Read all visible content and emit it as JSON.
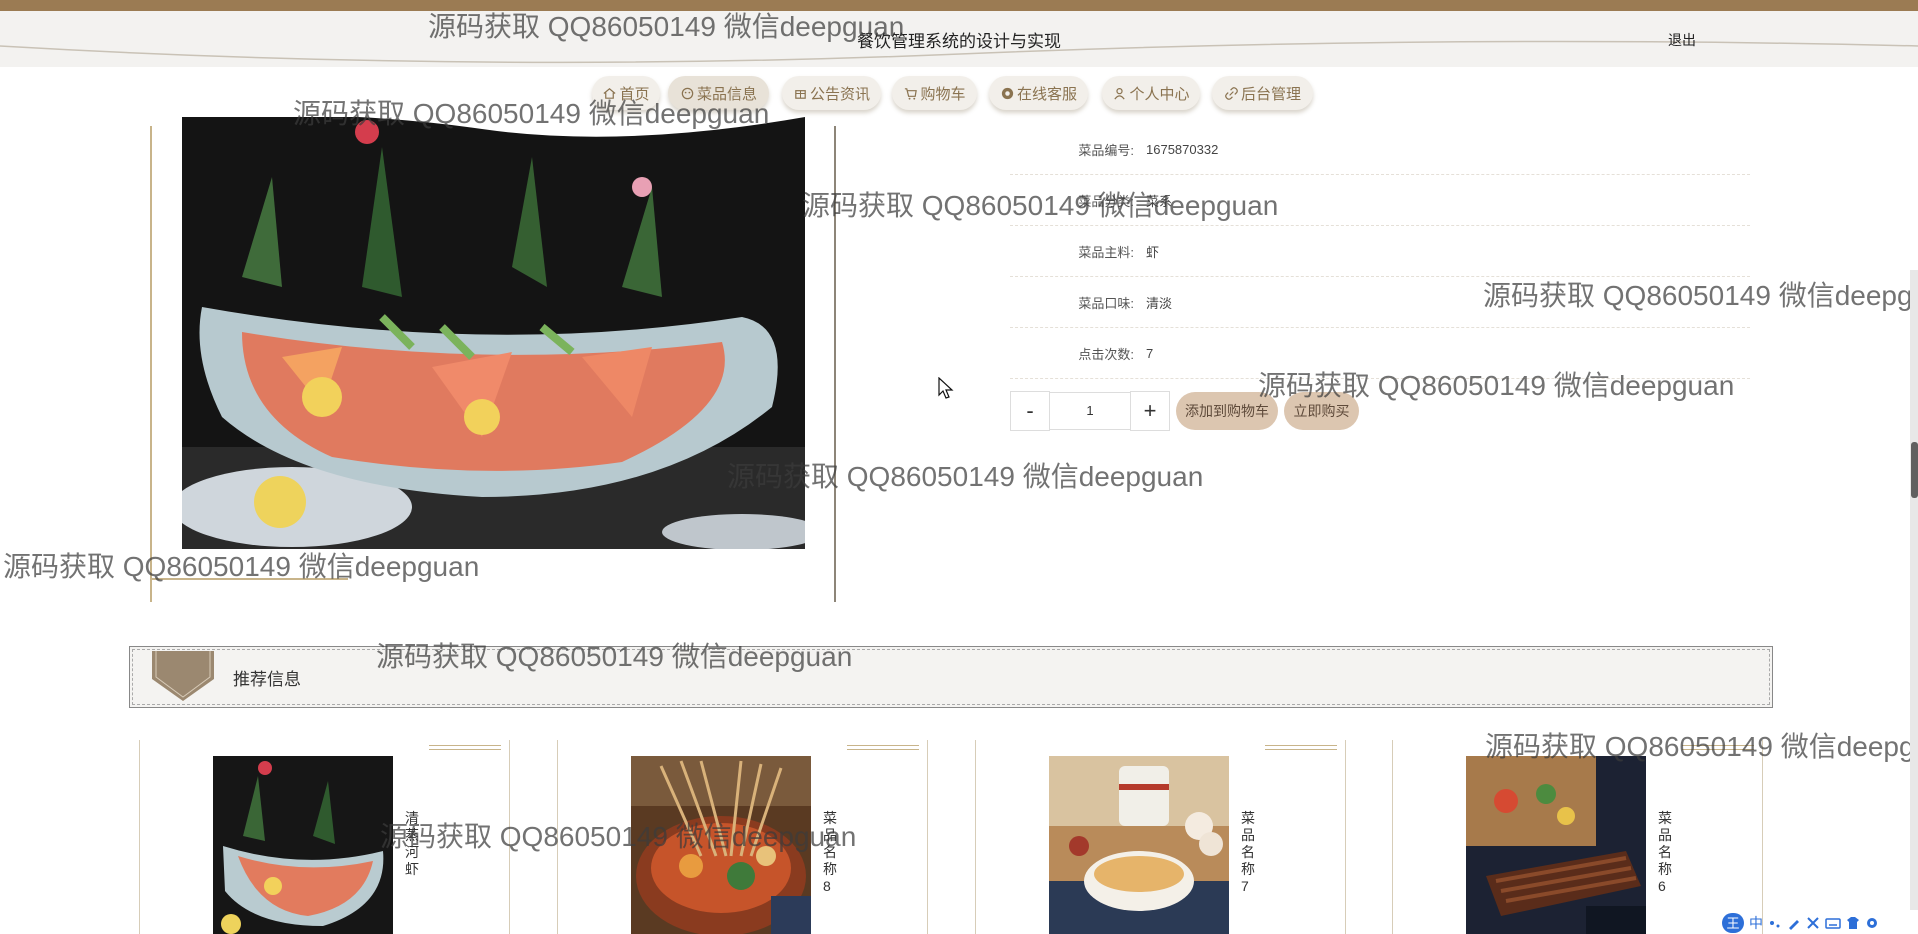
{
  "header": {
    "site_title": "餐饮管理系统的设计与实现",
    "logout_label": "退出"
  },
  "nav": {
    "items": [
      {
        "label": "首页",
        "icon": "home-icon"
      },
      {
        "label": "菜品信息",
        "icon": "dish-icon"
      },
      {
        "label": "公告资讯",
        "icon": "news-icon"
      },
      {
        "label": "购物车",
        "icon": "cart-icon"
      },
      {
        "label": "在线客服",
        "icon": "chat-icon"
      },
      {
        "label": "个人中心",
        "icon": "user-icon"
      },
      {
        "label": "后台管理",
        "icon": "link-icon"
      }
    ],
    "active_index": 1
  },
  "detail": {
    "attributes": [
      {
        "label": "菜品编号:",
        "value": "1675870332"
      },
      {
        "label": "菜品分类:",
        "value": "菜系"
      },
      {
        "label": "菜品主料:",
        "value": "虾"
      },
      {
        "label": "菜品口味:",
        "value": "清淡"
      },
      {
        "label": "点击次数:",
        "value": "7"
      }
    ],
    "quantity": {
      "minus": "-",
      "value": "1",
      "plus": "+"
    },
    "add_to_cart_label": "添加到购物车",
    "buy_now_label": "立即购买"
  },
  "recommend": {
    "title": "推荐信息",
    "cards": [
      {
        "name": "清蒸河虾"
      },
      {
        "name": "菜品名称8"
      },
      {
        "name": "菜品名称7"
      },
      {
        "name": "菜品名称6"
      }
    ]
  },
  "watermark_text": "源码获取 QQ86050149 微信deepguan",
  "ime": {
    "logo": "王",
    "mode": "中"
  },
  "colors": {
    "accent_brown": "#9b7b53",
    "header_bg": "#f3f2f0",
    "nav_text": "#8a7350",
    "pill_button": "#dcc6b0"
  }
}
